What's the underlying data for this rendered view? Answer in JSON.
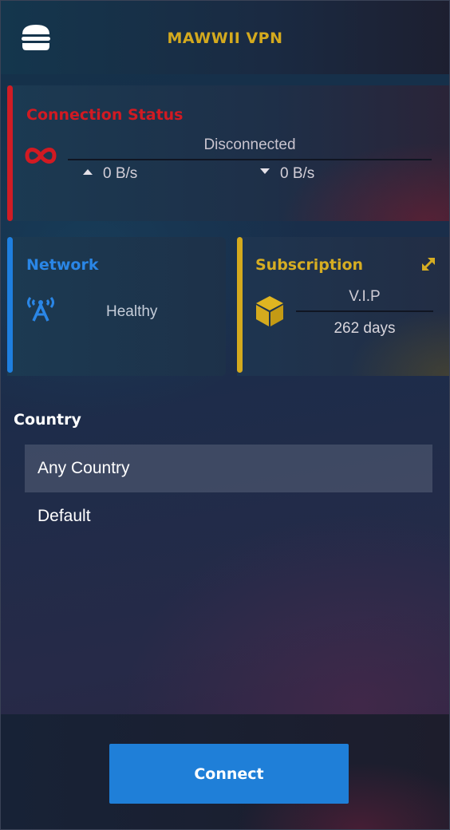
{
  "app": {
    "title": "MAWWII VPN"
  },
  "header": {
    "menu_icon": "hamburger-menu-icon"
  },
  "connection": {
    "title": "Connection Status",
    "status": "Disconnected",
    "upload_rate": "0 B/s",
    "download_rate": "0 B/s",
    "icon": "infinity-icon",
    "accent_color": "#d01c24"
  },
  "network": {
    "title": "Network",
    "status": "Healthy",
    "icon": "antenna-icon",
    "accent_color": "#1e7fe0"
  },
  "subscription": {
    "title": "Subscription",
    "plan": "V.I.P",
    "remaining": "262 days",
    "icon": "cube-icon",
    "expand_icon": "expand-icon",
    "accent_color": "#d4aa1e"
  },
  "country": {
    "label": "Country",
    "options": [
      "Any Country",
      "Default"
    ],
    "selected": "Any Country"
  },
  "footer": {
    "connect_label": "Connect",
    "button_color": "#1f7fd8"
  }
}
